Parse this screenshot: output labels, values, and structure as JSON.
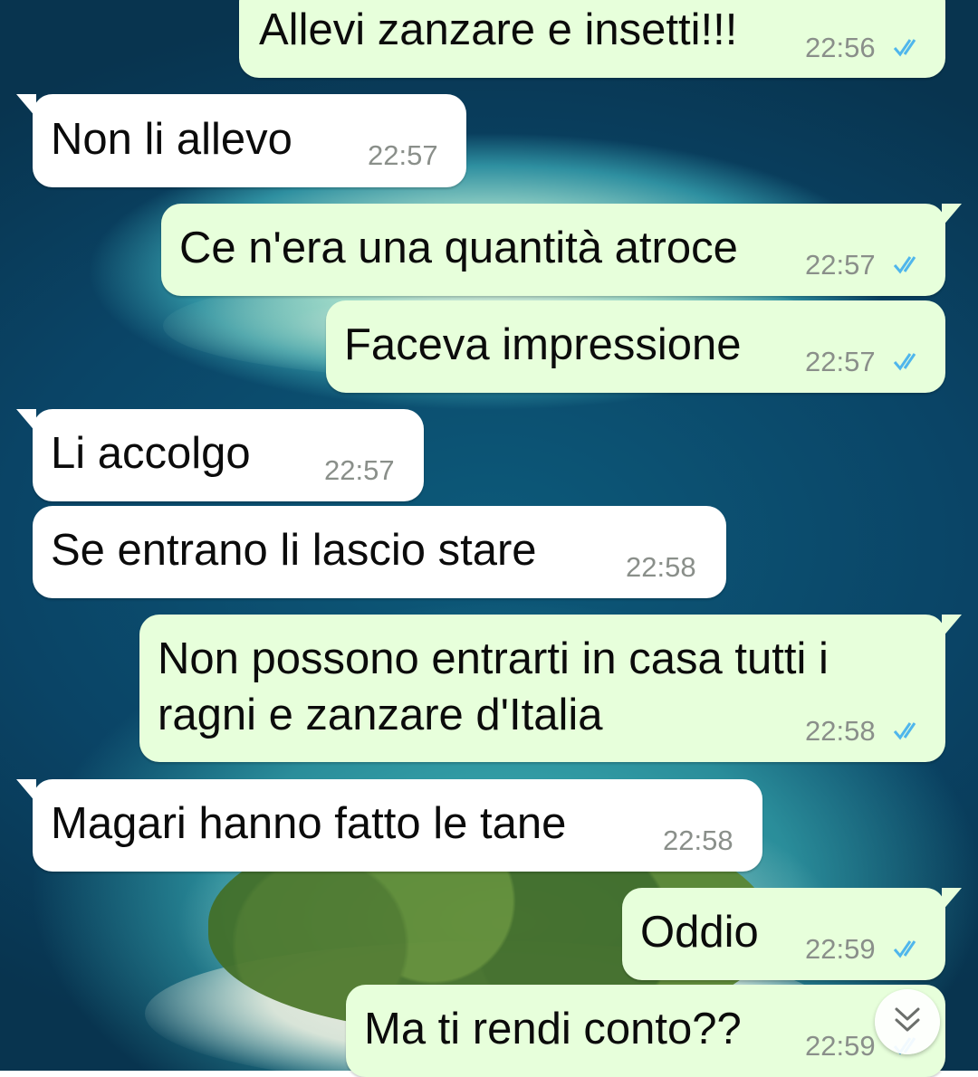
{
  "messages": [
    {
      "direction": "outgoing",
      "text": "Allevi zanzare e insetti!!!",
      "time": "22:56",
      "status": "read"
    },
    {
      "direction": "incoming",
      "text": "Non li allevo",
      "time": "22:57"
    },
    {
      "direction": "outgoing",
      "text": "Ce n'era una quantità atroce",
      "time": "22:57",
      "status": "read"
    },
    {
      "direction": "outgoing",
      "text": "Faceva impressione",
      "time": "22:57",
      "status": "read"
    },
    {
      "direction": "incoming",
      "text": "Li accolgo",
      "time": "22:57"
    },
    {
      "direction": "incoming",
      "text": "Se entrano li lascio stare",
      "time": "22:58"
    },
    {
      "direction": "outgoing",
      "text": "Non possono entrarti in casa tutti i\nragni e zanzare d'Italia",
      "time": "22:58",
      "status": "read"
    },
    {
      "direction": "incoming",
      "text": "Magari hanno fatto le tane",
      "time": "22:58"
    },
    {
      "direction": "outgoing",
      "text": "Oddio",
      "time": "22:59",
      "status": "read"
    },
    {
      "direction": "outgoing",
      "text": "Ma ti rendi conto??",
      "time": "22:59",
      "status": "read"
    }
  ],
  "colors": {
    "incoming_bubble": "#ffffff",
    "outgoing_bubble": "#e7ffdb",
    "read_ticks": "#4fb6ec",
    "timestamp": "#8a8f8a"
  },
  "icons": {
    "read_receipt": "double-check-icon",
    "scroll_down": "double-chevron-down-icon"
  }
}
